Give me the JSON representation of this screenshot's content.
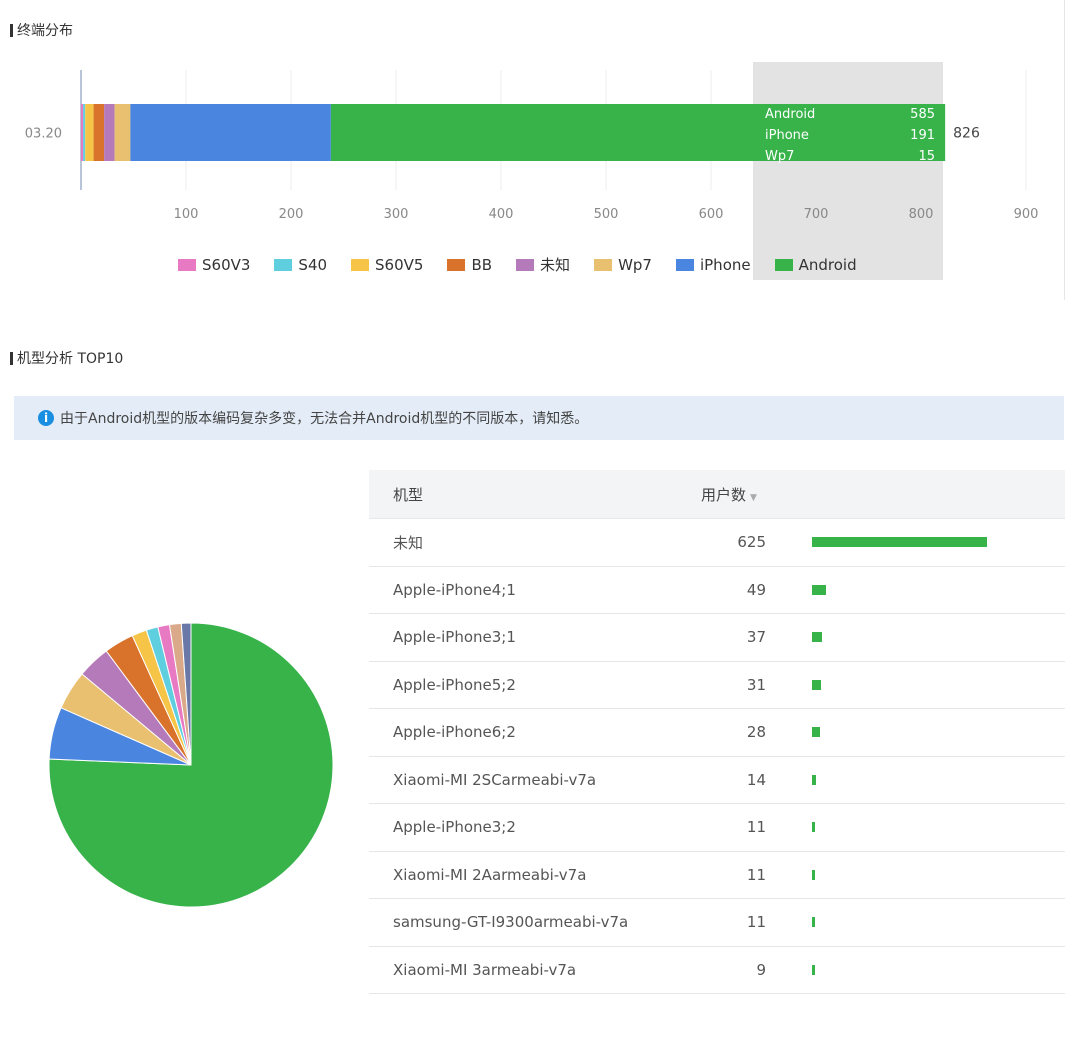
{
  "sections": {
    "terminal_title": "终端分布",
    "model_title": "机型分析 TOP10"
  },
  "notice": {
    "icon": "info-icon",
    "text": "由于Android机型的版本编码复杂多变，无法合并Android机型的不同版本，请知悉。"
  },
  "colors": {
    "S60V3": "#e87ac4",
    "S40": "#5fcfe0",
    "S60V5": "#f6c548",
    "BB": "#d9722a",
    "未知": "#b57ab9",
    "Wp7": "#e8c070",
    "iPhone": "#4a86e0",
    "Android": "#37b34a"
  },
  "chart_data": [
    {
      "type": "bar",
      "orientation": "horizontal",
      "stacked": true,
      "categories": [
        "03.20"
      ],
      "series": [
        {
          "name": "S60V3",
          "values": [
            2
          ]
        },
        {
          "name": "S40",
          "values": [
            2
          ]
        },
        {
          "name": "S60V5",
          "values": [
            8
          ]
        },
        {
          "name": "BB",
          "values": [
            10
          ]
        },
        {
          "name": "未知",
          "values": [
            10
          ]
        },
        {
          "name": "Wp7",
          "values": [
            15
          ]
        },
        {
          "name": "iPhone",
          "values": [
            191
          ]
        },
        {
          "name": "Android",
          "values": [
            585
          ]
        }
      ],
      "total_label": "826",
      "xlim": [
        0,
        900
      ],
      "xticks": [
        "100",
        "200",
        "300",
        "400",
        "500",
        "600",
        "700",
        "800",
        "900"
      ],
      "legend": [
        "S60V3",
        "S40",
        "S60V5",
        "BB",
        "未知",
        "Wp7",
        "iPhone",
        "Android"
      ],
      "legend_position": "bottom",
      "tooltip": {
        "rows": [
          {
            "label": "Android",
            "value": "585"
          },
          {
            "label": "iPhone",
            "value": "191"
          },
          {
            "label": "Wp7",
            "value": "15"
          }
        ]
      }
    },
    {
      "type": "pie",
      "slices": [
        {
          "name": "未知",
          "value": 625,
          "color": "#37b34a"
        },
        {
          "name": "Apple-iPhone4;1",
          "value": 49,
          "color": "#4a86e0"
        },
        {
          "name": "Apple-iPhone3;1",
          "value": 37,
          "color": "#e8c070"
        },
        {
          "name": "Apple-iPhone5;2",
          "value": 31,
          "color": "#b57ab9"
        },
        {
          "name": "Apple-iPhone6;2",
          "value": 28,
          "color": "#d9722a"
        },
        {
          "name": "Xiaomi-MI 2SCarmeabi-v7a",
          "value": 14,
          "color": "#f6c548"
        },
        {
          "name": "Apple-iPhone3;2",
          "value": 11,
          "color": "#5fcfe0"
        },
        {
          "name": "Xiaomi-MI 2Aarmeabi-v7a",
          "value": 11,
          "color": "#e87ac4"
        },
        {
          "name": "samsung-GT-I9300armeabi-v7a",
          "value": 11,
          "color": "#d9a98a"
        },
        {
          "name": "Xiaomi-MI 3armeabi-v7a",
          "value": 9,
          "color": "#6a78a8"
        }
      ]
    }
  ],
  "table": {
    "headers": {
      "model": "机型",
      "users": "用户数",
      "sort_icon": "sort-icon"
    },
    "rows": [
      {
        "model": "未知",
        "users": "625",
        "share": 1.0
      },
      {
        "model": "Apple-iPhone4;1",
        "users": "49",
        "share": 0.078
      },
      {
        "model": "Apple-iPhone3;1",
        "users": "37",
        "share": 0.059
      },
      {
        "model": "Apple-iPhone5;2",
        "users": "31",
        "share": 0.05
      },
      {
        "model": "Apple-iPhone6;2",
        "users": "28",
        "share": 0.045
      },
      {
        "model": "Xiaomi-MI 2SCarmeabi-v7a",
        "users": "14",
        "share": 0.022
      },
      {
        "model": "Apple-iPhone3;2",
        "users": "11",
        "share": 0.018
      },
      {
        "model": "Xiaomi-MI 2Aarmeabi-v7a",
        "users": "11",
        "share": 0.018
      },
      {
        "model": "samsung-GT-I9300armeabi-v7a",
        "users": "11",
        "share": 0.018
      },
      {
        "model": "Xiaomi-MI 3armeabi-v7a",
        "users": "9",
        "share": 0.014
      }
    ]
  }
}
